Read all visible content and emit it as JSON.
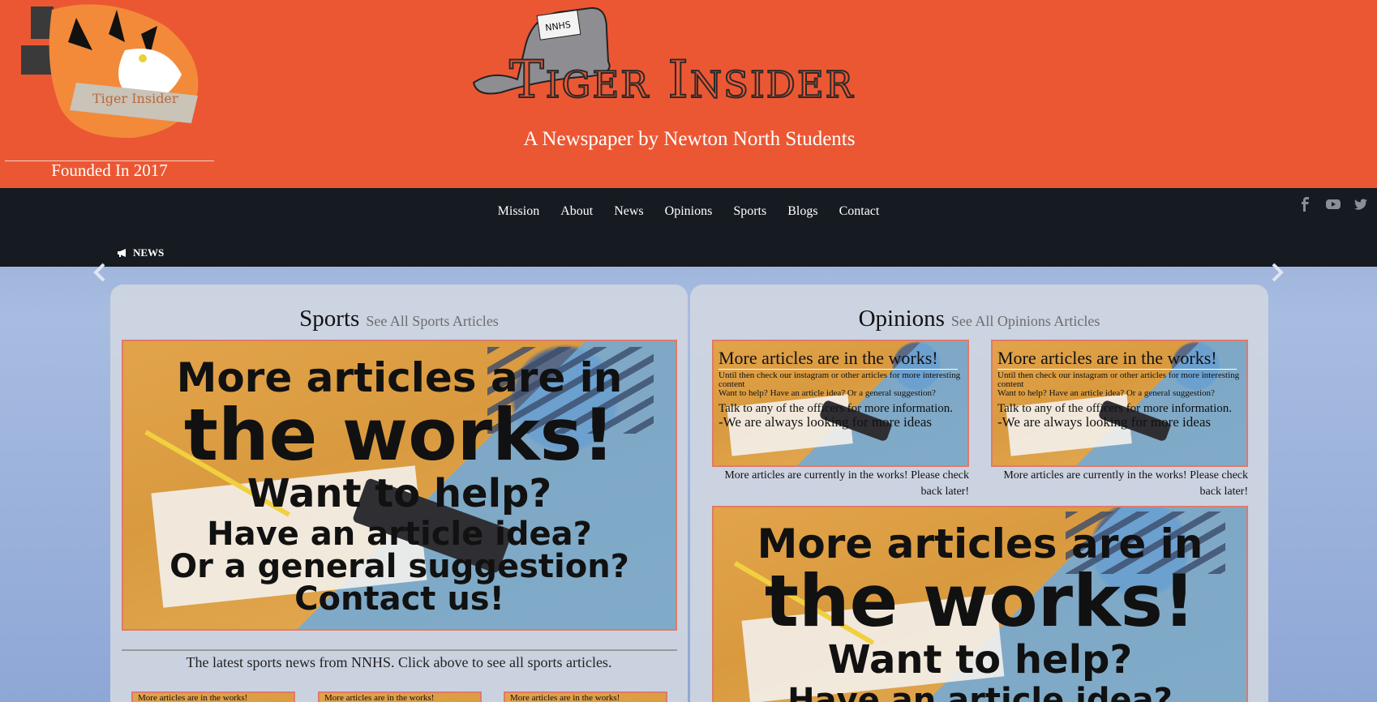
{
  "header": {
    "founded": "Founded In 2017",
    "masthead_title": "Tiger Insider",
    "hat_badge": "NNHS",
    "logo_banner": "Tiger Insider",
    "tagline": "A Newspaper by Newton North Students"
  },
  "nav": {
    "items": [
      "Mission",
      "About",
      "News",
      "Opinions",
      "Sports",
      "Blogs",
      "Contact"
    ],
    "ticker_label": "NEWS",
    "social": [
      "facebook-icon",
      "youtube-icon",
      "twitter-icon"
    ]
  },
  "sports": {
    "title": "Sports",
    "link": "See All Sports Articles",
    "description": "The latest sports news from NNHS. Click above to see all sports articles.",
    "thumb_text": "More articles are in the works!"
  },
  "opinions": {
    "title": "Opinions",
    "link": "See All Opinions Articles",
    "card_caption": "More articles are currently in the works! Please check back later!"
  },
  "placeholder_big": {
    "line1": "More articles are in",
    "line2": "the works!",
    "line3": "Want to help?",
    "line4": "Have an article idea?",
    "line5": "Or a general suggestion?",
    "line6": "Contact us!"
  },
  "placeholder_small": {
    "line1": "More articles are in the works!",
    "line2": "Until then check our instagram or other articles for more interesting content",
    "line3": "Want to help? Have an article idea? Or a general suggestion?",
    "line4": "Talk to any of the officers for more information.",
    "line5": "-We are always looking for more ideas"
  },
  "colors": {
    "header_bg": "#ec5733",
    "nav_bg": "#161b21",
    "panel_bg": "#ced4e0"
  }
}
